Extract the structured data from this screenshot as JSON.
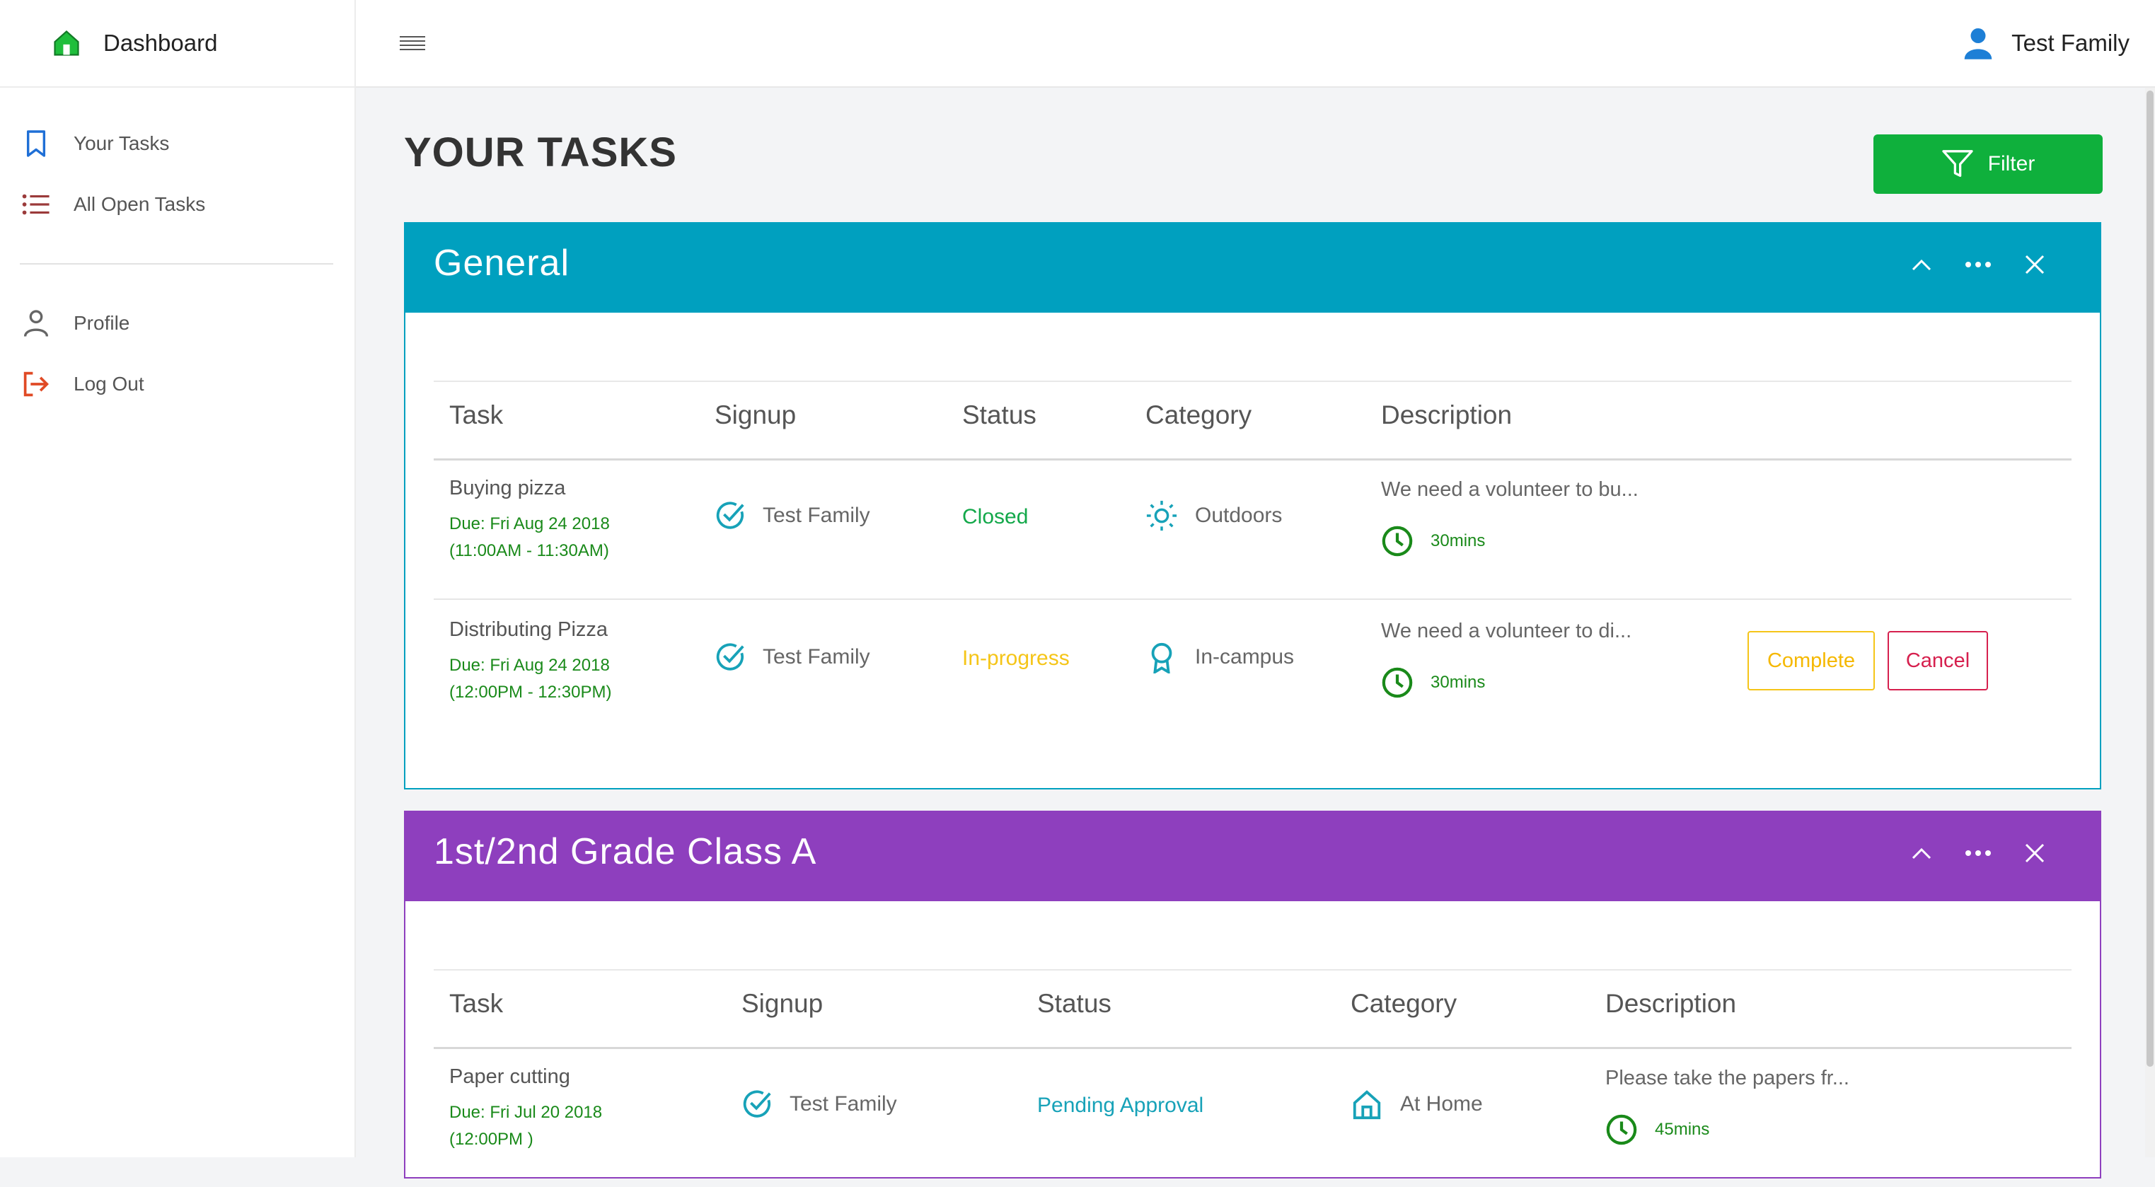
{
  "app": {
    "brand": "Dashboard",
    "user_name": "Test Family"
  },
  "sidebar": {
    "items": [
      {
        "label": "Your Tasks",
        "icon": "bookmark-icon"
      },
      {
        "label": "All Open Tasks",
        "icon": "list-icon"
      },
      {
        "label": "Profile",
        "icon": "person-icon"
      },
      {
        "label": "Log Out",
        "icon": "logout-icon"
      }
    ]
  },
  "main": {
    "title": "YOUR TASKS",
    "filter_label": "Filter"
  },
  "columns": {
    "task": "Task",
    "signup": "Signup",
    "status": "Status",
    "category": "Category",
    "description": "Description"
  },
  "groups": [
    {
      "title": "General",
      "color": "#00a0bf",
      "rows": [
        {
          "task": "Buying pizza",
          "due": "Due: Fri Aug 24 2018",
          "time": "(11:00AM - 11:30AM)",
          "signup": "Test Family",
          "status": "Closed",
          "status_color": "#13a84a",
          "category": "Outdoors",
          "category_icon": "sun-icon",
          "description": "We need a volunteer to bu...",
          "duration": "30mins"
        },
        {
          "task": "Distributing Pizza",
          "due": "Due: Fri Aug 24 2018",
          "time": "(12:00PM - 12:30PM)",
          "signup": "Test Family",
          "status": "In-progress",
          "status_color": "#f5c518",
          "category": "In-campus",
          "category_icon": "award-icon",
          "description": "We need a volunteer to di...",
          "duration": "30mins",
          "complete_label": "Complete",
          "cancel_label": "Cancel"
        }
      ]
    },
    {
      "title": "1st/2nd Grade Class A",
      "color": "#8e3fbe",
      "rows": [
        {
          "task": "Paper cutting",
          "due": "Due: Fri Jul 20 2018",
          "time": "(12:00PM )",
          "signup": "Test Family",
          "status": "Pending Approval",
          "status_color": "#17a2b8",
          "category": "At Home",
          "category_icon": "home-icon",
          "description": "Please take the papers fr...",
          "duration": "45mins"
        }
      ]
    }
  ]
}
